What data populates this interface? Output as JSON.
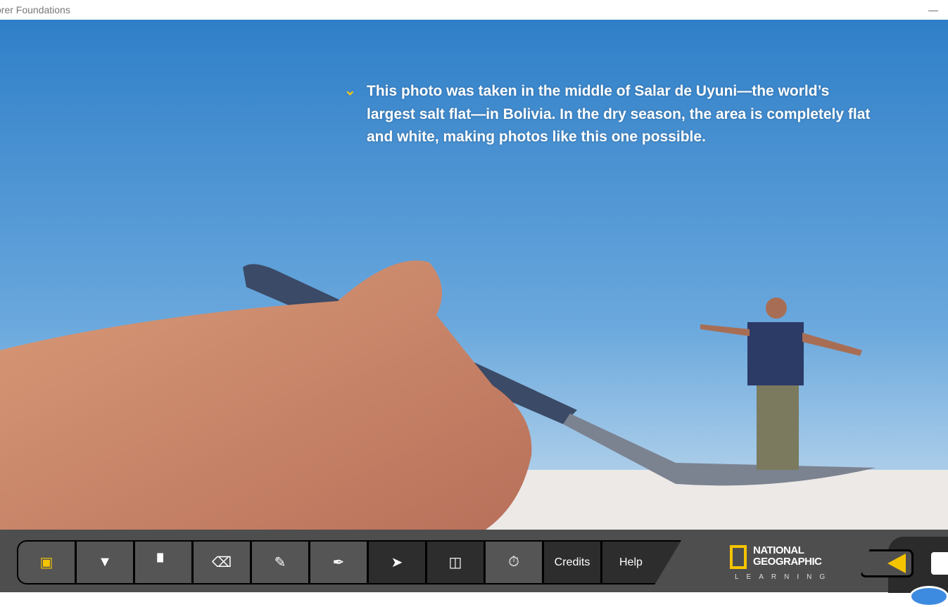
{
  "window": {
    "title": "orer Foundations",
    "minimize_label": "—"
  },
  "photo": {
    "caption": "This photo was taken in the middle of Salar de Uyuni—the world’s largest salt flat—in Bolivia. In the dry season, the area is completely flat and white, making photos like this one possible."
  },
  "toolbar": {
    "tools": [
      {
        "icon": "media-icon"
      },
      {
        "icon": "projector-screen-icon"
      },
      {
        "icon": "squares-icon"
      },
      {
        "icon": "eraser-icon"
      },
      {
        "icon": "pencil-icon"
      },
      {
        "icon": "pen-icon"
      },
      {
        "icon": "pointer-icon"
      },
      {
        "icon": "book-icon"
      },
      {
        "icon": "stopwatch-icon"
      }
    ],
    "credits_label": "Credits",
    "help_label": "Help"
  },
  "logo": {
    "line1": "NATIONAL",
    "line2": "GEOGRAPHIC",
    "line3": "LEARNING"
  },
  "colors": {
    "accent": "#f5c400",
    "toolbar": "#4e4e4e",
    "sky": "#3f8ccf"
  }
}
